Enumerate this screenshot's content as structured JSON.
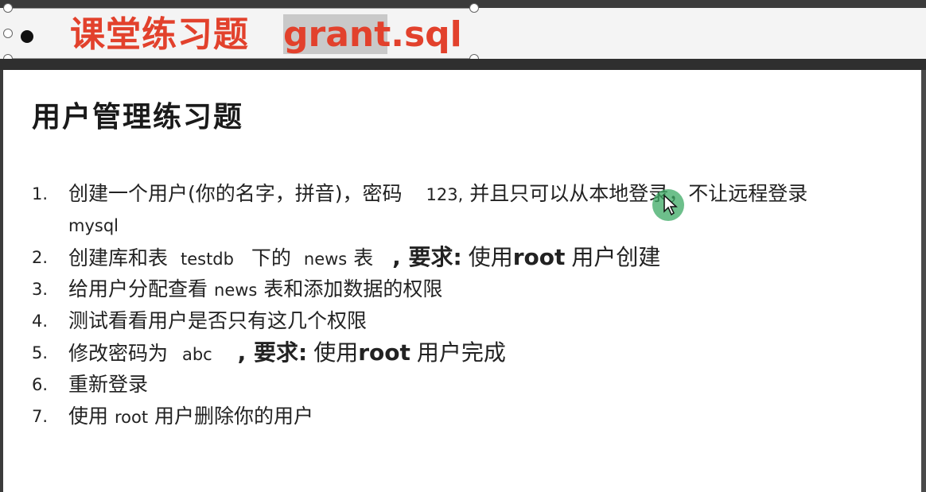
{
  "header": {
    "title_cn": "课堂练习题",
    "title_file": "grant.sql",
    "title_color": "#e2412c"
  },
  "slide": {
    "heading": "用户管理练习题",
    "items": [
      {
        "num": "1.",
        "parts": [
          "创建一个用户(你的名字，拼音)，密码",
          "123,",
          "并且只可以从本地登录，不让远程登录"
        ],
        "cont": "mysql"
      },
      {
        "num": "2.",
        "parts": [
          "创建库和表",
          "testdb",
          "下的",
          "news",
          "表",
          ", 要求:",
          "使用",
          "root",
          "用户创建"
        ]
      },
      {
        "num": "3.",
        "parts": [
          "给用户分配查看",
          "news",
          "表和添加数据的权限"
        ]
      },
      {
        "num": "4.",
        "parts": [
          "测试看看用户是否只有这几个权限"
        ]
      },
      {
        "num": "5.",
        "parts": [
          "修改密码为",
          "abc",
          ", 要求:",
          "使用",
          "root",
          "用户完成"
        ]
      },
      {
        "num": "6.",
        "parts": [
          "重新登录"
        ]
      },
      {
        "num": "7.",
        "parts": [
          "使用",
          "root",
          "用户删除你的用户"
        ]
      }
    ]
  }
}
